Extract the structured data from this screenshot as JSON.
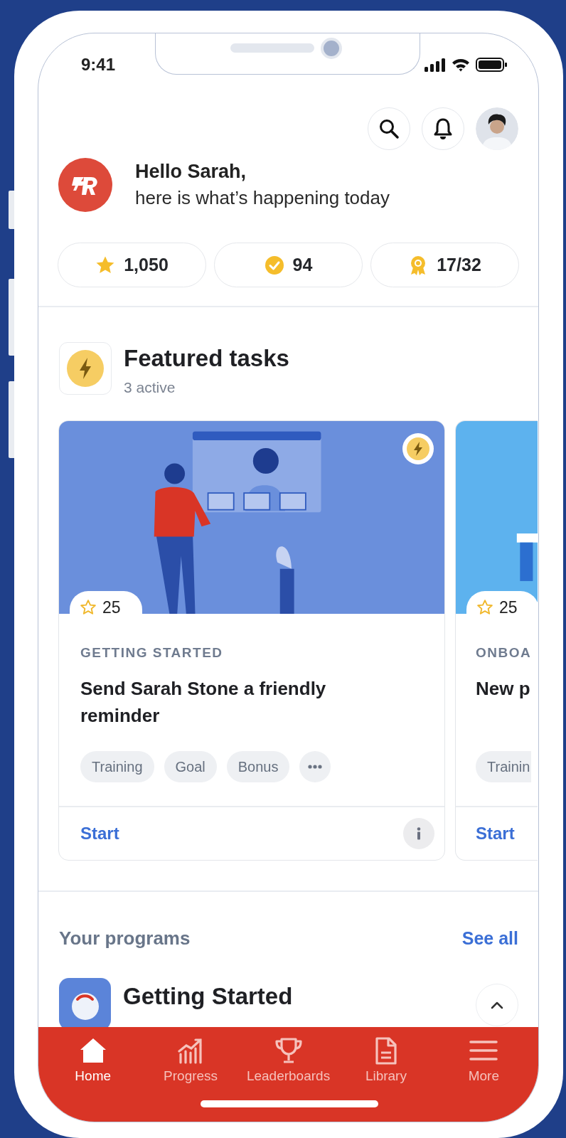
{
  "status_bar": {
    "time": "9:41"
  },
  "header": {
    "greeting": "Hello Sarah,",
    "subtitle": "here is what’s happening today"
  },
  "stats": [
    {
      "kind": "star",
      "value": "1,050"
    },
    {
      "kind": "check",
      "value": "94"
    },
    {
      "kind": "award",
      "value": "17/32"
    }
  ],
  "featured": {
    "title": "Featured tasks",
    "subtitle": "3 active",
    "cards": [
      {
        "points": "25",
        "category": "GETTING STARTED",
        "title": "Send Sarah Stone a friendly reminder",
        "tags": [
          "Training",
          "Goal",
          "Bonus"
        ],
        "more": true,
        "action": "Start",
        "info": true,
        "featured": true,
        "image": {
          "kind": "picture"
        }
      },
      {
        "points": "25",
        "category": "ONBOA",
        "title": "New p",
        "tags": [
          "Trainin"
        ],
        "action": "Start",
        "image": {
          "kind": "picture"
        }
      }
    ]
  },
  "programs": {
    "title": "Your programs",
    "see_all": "See all",
    "items": [
      {
        "title": "Getting Started",
        "expanded": true
      }
    ]
  },
  "nav": [
    {
      "kind": "home",
      "label": "Home",
      "selected": true
    },
    {
      "kind": "progress",
      "label": "Progress",
      "selected": false
    },
    {
      "kind": "trophy",
      "label": "Leaderboards",
      "selected": false
    },
    {
      "kind": "document",
      "label": "Library",
      "selected": false
    },
    {
      "kind": "menu",
      "label": "More",
      "selected": false
    }
  ]
}
